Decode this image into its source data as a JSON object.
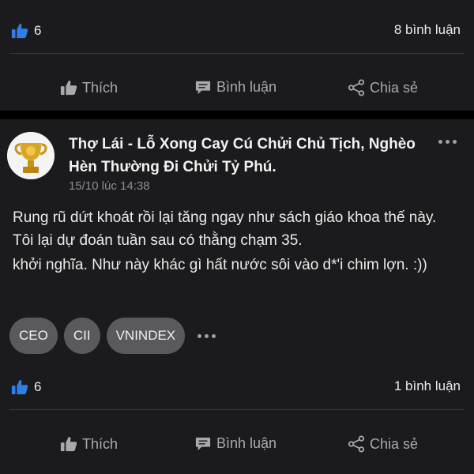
{
  "top_post": {
    "likes": "6",
    "comments": "8 bình luận",
    "actions": {
      "like": "Thích",
      "comment": "Bình luận",
      "share": "Chia sẻ"
    }
  },
  "post": {
    "author": "Thợ Lái - Lỗ Xong Cay Cú Chửi Chủ Tịch, Nghèo Hèn Thường Đi Chửi Tỷ Phú.",
    "timestamp": "15/10 lúc 14:38",
    "body": "Rung rũ dứt khoát rồi lại tăng ngay như sách giáo khoa thế này. Tôi lại dự đoán tuần sau có thằng chạm 35.",
    "body_cont": "khởi nghĩa. Như này khác gì hất nước sôi vào d*'i chim lợn. :))",
    "tags": [
      "CEO",
      "CII",
      "VNINDEX"
    ],
    "likes": "6",
    "comments": "1 bình luận",
    "actions": {
      "like": "Thích",
      "comment": "Bình luận",
      "share": "Chia sẻ"
    }
  },
  "colors": {
    "background": "#1b1b1d",
    "like_blue": "#2f7fe6",
    "tag_bg": "#5a5a5e",
    "muted_text": "#a9a9ab"
  }
}
